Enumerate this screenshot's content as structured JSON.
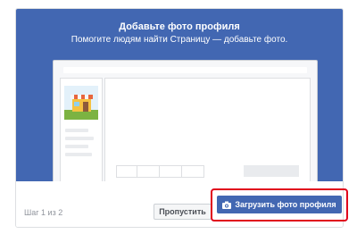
{
  "dialog": {
    "title": "Добавьте фото профиля",
    "subtitle": "Помогите людям найти Страницу — добавьте фото."
  },
  "footer": {
    "step_text": "Шаг 1 из 2",
    "skip_label": "Пропустить",
    "upload_label": "Загрузить фото профиля"
  },
  "icons": {
    "upload": "camera-icon",
    "preview_picture": "storefront-icon"
  },
  "colors": {
    "hero_background": "#4267b2",
    "primary_button": "#4267b2",
    "highlight_border": "#e0001b"
  }
}
